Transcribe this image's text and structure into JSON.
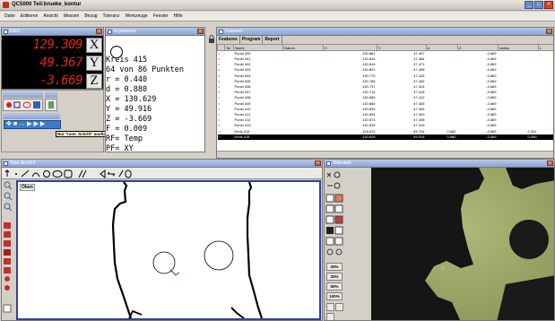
{
  "window": {
    "title": "QC5000 Teil:brueke_kontur"
  },
  "menu": [
    "Datei",
    "Editieren",
    "Ansicht",
    "Messen",
    "Bezug",
    "Toleranz",
    "Werkzeuge",
    "Fenster",
    "Hilfe"
  ],
  "dro": {
    "caption": "DRO",
    "rows": [
      {
        "value": "129.309",
        "axis": "X"
      },
      {
        "value": "49.367",
        "axis": "Y"
      },
      {
        "value": "-3.669",
        "axis": "Z"
      }
    ]
  },
  "panel": {
    "tooltip": "Nur \"nom. Schritt\" ausführen"
  },
  "results": {
    "caption": "Ergebnisse",
    "lines": [
      "Kreis 415",
      "64 von 86 Punkten",
      "r =   0.440",
      "d =   0.880",
      "X = 130.629",
      "Y =  49.916",
      "Z =  -3.669",
      "F =   0.009",
      "RF= Temp",
      "PF= XY"
    ]
  },
  "features": {
    "caption": "Features",
    "tabs": [
      "Features",
      "Program",
      "Report"
    ],
    "columns": [
      "",
      "Tol",
      "Name",
      "Datum",
      "X",
      "Y",
      "d",
      "Z",
      "radius",
      "L"
    ],
    "rows": [
      [
        "•",
        "",
        "Punkt 400",
        "",
        "130.861",
        "47.497",
        "",
        "-3.669",
        "",
        ""
      ],
      [
        "•",
        "",
        "Punkt 401",
        "",
        "130.842",
        "47.484",
        "",
        "-3.669",
        "",
        ""
      ],
      [
        "•",
        "",
        "Punkt 402",
        "",
        "130.819",
        "47.471",
        "",
        "-3.669",
        "",
        ""
      ],
      [
        "•",
        "",
        "Punkt 403",
        "",
        "130.801",
        "47.458",
        "",
        "-3.669",
        "",
        ""
      ],
      [
        "•",
        "",
        "Punkt 404",
        "",
        "130.779",
        "47.445",
        "",
        "-3.669",
        "",
        ""
      ],
      [
        "•",
        "",
        "Punkt 405",
        "",
        "130.758",
        "47.435",
        "",
        "-3.669",
        "",
        ""
      ],
      [
        "•",
        "",
        "Punkt 406",
        "",
        "130.737",
        "47.424",
        "",
        "-3.669",
        "",
        ""
      ],
      [
        "•",
        "",
        "Punkt 407",
        "",
        "130.714",
        "47.418",
        "",
        "-3.669",
        "",
        ""
      ],
      [
        "•",
        "",
        "Punkt 408",
        "",
        "130.689",
        "47.412",
        "",
        "-3.669",
        "",
        ""
      ],
      [
        "•",
        "",
        "Punkt 409",
        "",
        "130.664",
        "47.408",
        "",
        "-3.669",
        "",
        ""
      ],
      [
        "•",
        "",
        "Punkt 410",
        "",
        "130.635",
        "47.404",
        "",
        "-3.669",
        "",
        ""
      ],
      [
        "•",
        "",
        "Punkt 411",
        "",
        "130.604",
        "47.403",
        "",
        "-3.669",
        "",
        ""
      ],
      [
        "•",
        "",
        "Punkt 412",
        "",
        "130.573",
        "47.408",
        "",
        "-3.669",
        "",
        ""
      ],
      [
        "•",
        "",
        "Punkt 413",
        "",
        "130.539",
        "47.415",
        "",
        "-3.669",
        "",
        ""
      ],
      [
        "○",
        "",
        "Kreis 414",
        "",
        "128.875",
        "49.704",
        "0.682",
        "-3.669",
        "0.341",
        ""
      ],
      [
        "○",
        "",
        "Kreis 415",
        "",
        "130.629",
        "49.916",
        "0.880",
        "-3.669",
        "0.440",
        ""
      ]
    ],
    "selected_row": 15
  },
  "part_view": {
    "caption": "Teile-Ansicht",
    "view_label": "Oben"
  },
  "video": {
    "caption": "Videobild",
    "zoom_levels": [
      "25%",
      "33%",
      "50%",
      "100%"
    ]
  }
}
